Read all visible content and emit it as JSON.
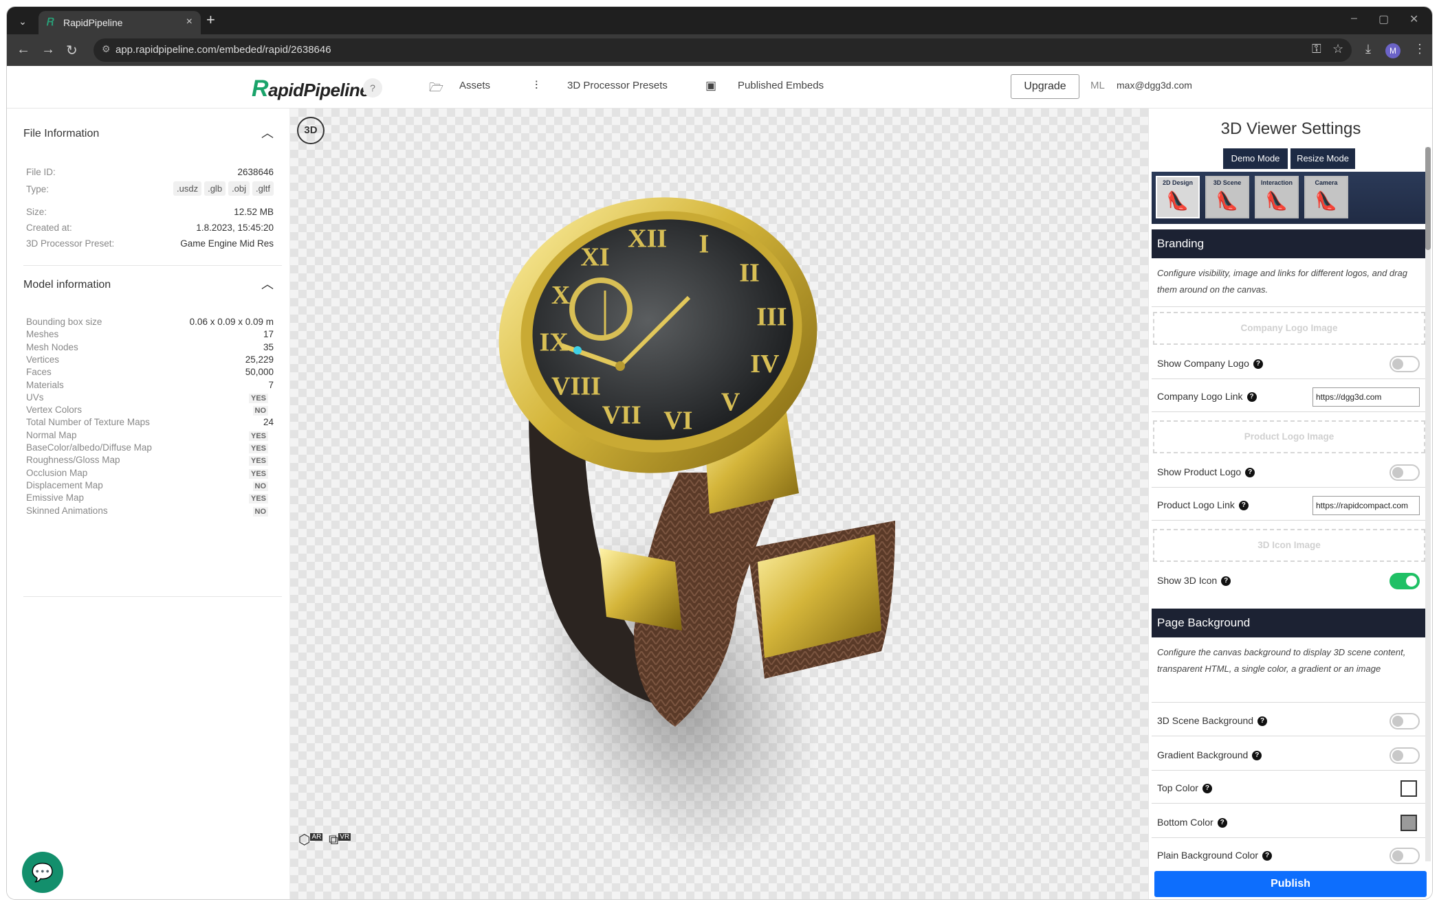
{
  "browser": {
    "tab_title": "RapidPipeline",
    "url": "app.rapidpipeline.com/embeded/rapid/2638646",
    "profile_initial": "M"
  },
  "header": {
    "logo_text": "apidPipeline",
    "logo_letter": "R",
    "help": "?",
    "nav": [
      {
        "label": "Assets"
      },
      {
        "label": "3D Processor Presets"
      },
      {
        "label": "Published Embeds"
      }
    ],
    "upgrade": "Upgrade",
    "user_initials": "ML",
    "user_email": "max@dgg3d.com"
  },
  "file_info": {
    "title": "File Information",
    "rows": [
      {
        "k": "File ID:",
        "v": "2638646"
      },
      {
        "k": "Size:",
        "v": "12.52 MB"
      },
      {
        "k": "Created at:",
        "v": "1.8.2023, 15:45:20"
      },
      {
        "k": "3D Processor Preset:",
        "v": "Game Engine Mid Res"
      }
    ],
    "type_label": "Type:",
    "types": [
      ".usdz",
      ".glb",
      ".obj",
      ".gltf"
    ]
  },
  "model_info": {
    "title": "Model information",
    "rows": [
      {
        "k": "Bounding box size",
        "v": "0.06 x 0.09 x 0.09 m"
      },
      {
        "k": "Meshes",
        "v": "17"
      },
      {
        "k": "Mesh Nodes",
        "v": "35"
      },
      {
        "k": "Vertices",
        "v": "25,229"
      },
      {
        "k": "Faces",
        "v": "50,000"
      },
      {
        "k": "Materials",
        "v": "7"
      },
      {
        "k": "UVs",
        "v": "YES"
      },
      {
        "k": "Vertex Colors",
        "v": "NO"
      },
      {
        "k": "Total Number of Texture Maps",
        "v": "24"
      },
      {
        "k": "Normal Map",
        "v": "YES"
      },
      {
        "k": "BaseColor/albedo/Diffuse Map",
        "v": "YES"
      },
      {
        "k": "Roughness/Gloss Map",
        "v": "YES"
      },
      {
        "k": "Occlusion Map",
        "v": "YES"
      },
      {
        "k": "Displacement Map",
        "v": "NO"
      },
      {
        "k": "Emissive Map",
        "v": "YES"
      },
      {
        "k": "Skinned Animations",
        "v": "NO"
      }
    ]
  },
  "viewer": {
    "badge": "3D",
    "ar": "AR",
    "vr": "VR",
    "watch_numerals": [
      "XII",
      "I",
      "II",
      "III",
      "IV",
      "V",
      "VI",
      "VII",
      "VIII",
      "IX",
      "X",
      "XI"
    ]
  },
  "settings": {
    "title": "3D Viewer Settings",
    "demo_mode": "Demo Mode",
    "resize_mode": "Resize Mode",
    "tabs": [
      "2D Design",
      "3D Scene",
      "Interaction",
      "Camera"
    ],
    "branding": {
      "title": "Branding",
      "desc": "Configure visibility, image and links for different logos, and drag them around on the canvas.",
      "company_logo_image": "Company Logo Image",
      "show_company_logo": "Show Company Logo",
      "company_logo_link": "Company Logo Link",
      "company_logo_url": "https://dgg3d.com",
      "product_logo_image": "Product Logo Image",
      "show_product_logo": "Show Product Logo",
      "product_logo_link": "Product Logo Link",
      "product_logo_url": "https://rapidcompact.com",
      "icon_image": "3D Icon Image",
      "show_3d_icon": "Show 3D Icon"
    },
    "page_bg": {
      "title": "Page Background",
      "desc": "Configure the canvas background to display 3D scene content, transparent HTML, a single color, a gradient or an image",
      "scene_bg": "3D Scene Background",
      "gradient_bg": "Gradient Background",
      "top_color": "Top Color",
      "bottom_color": "Bottom Color",
      "plain_bg": "Plain Background Color"
    },
    "publish": "Publish",
    "colors": {
      "top": "#ffffff",
      "bottom": "#9a9a9a",
      "accent": "#0d6efd",
      "toggle_on": "#1fc065"
    }
  }
}
